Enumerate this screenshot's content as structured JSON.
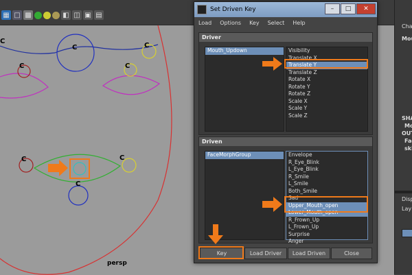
{
  "dialog": {
    "title": "Set Driven Key",
    "menu": [
      "Load",
      "Options",
      "Key",
      "Select",
      "Help"
    ],
    "driver": {
      "header": "Driver",
      "objects": [
        "Mouth_Updown"
      ],
      "attributes": [
        "Visibility",
        "Translate X",
        "Translate Y",
        "Translate Z",
        "Rotate X",
        "Rotate Y",
        "Rotate Z",
        "Scale X",
        "Scale Y",
        "Scale Z"
      ],
      "selected_attribute": "Translate Y"
    },
    "driven": {
      "header": "Driven",
      "objects": [
        "FaceMorphGroup"
      ],
      "attributes": [
        "Envelope",
        "R_Eye_Blink",
        "L_Eye_Blink",
        "R_Smile",
        "L_Smile",
        "Both_Smile",
        "Sad",
        "Upper_Mouth_open",
        "Lower_Mouth_open",
        "R_Frown_Up",
        "L_Frown_Up",
        "Surprise",
        "Anger"
      ],
      "selected_attributes": [
        "Upper_Mouth_open",
        "Lower_Mouth_open"
      ]
    },
    "buttons": {
      "key": "Key",
      "load_driver": "Load Driver",
      "load_driven": "Load Driven",
      "close": "Close"
    }
  },
  "viewport": {
    "camera_label": "persp",
    "control_letter": "C"
  },
  "right_panel": {
    "labels": [
      "Chan",
      "Mou",
      "SHA",
      "Mo",
      "OUT",
      "Fac",
      "ski",
      "Disp",
      "Lay"
    ]
  },
  "colors": {
    "highlight": "#f07a1a",
    "selection": "#6d8fb8",
    "viewport": "#9b9b9b"
  }
}
